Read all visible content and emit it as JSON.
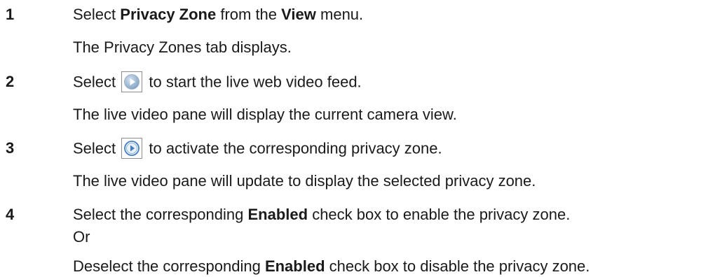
{
  "steps": [
    {
      "number": "1",
      "instruction": {
        "t1": "Select ",
        "b1": "Privacy Zone",
        "t2": " from the ",
        "b2": "View",
        "t3": " menu."
      },
      "result": "The Privacy Zones tab displays."
    },
    {
      "number": "2",
      "instruction": {
        "t1": "Select ",
        "icon": "play-icon",
        "t2": " to start the live web video feed."
      },
      "result": "The live video pane will display the current camera view."
    },
    {
      "number": "3",
      "instruction": {
        "t1": "Select ",
        "icon": "activate-zone-icon",
        "t2": " to activate the corresponding privacy zone."
      },
      "result": "The live video pane will update to display the selected privacy zone."
    },
    {
      "number": "4",
      "instruction": {
        "t1": "Select the corresponding ",
        "b1": "Enabled",
        "t2": " check box to enable the privacy zone."
      },
      "or": "Or",
      "alternative": {
        "t1": "Deselect the corresponding ",
        "b1": "Enabled",
        "t2": " check box to disable the privacy zone."
      }
    }
  ],
  "colors": {
    "text": "#1a1a1a",
    "play_icon": "#7f9fbf",
    "activate_icon": "#3f7fbf"
  }
}
